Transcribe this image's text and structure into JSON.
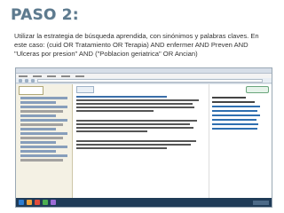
{
  "title": "PASO 2:",
  "instructions": "Utilizar la estrategia de búsqueda aprendida, con sinónimos y palabras claves. En este caso: (cuid OR Tratamiento OR Terapia) AND enfermer AND Preven AND \"Ulceras por presion\" AND (\"Poblacion geriatrica\" OR Ancian)",
  "screenshot": {
    "description_icons": [
      "browser-window",
      "database-logo",
      "results-list"
    ],
    "taskbar_icon_colors": [
      "#2e7dd1",
      "#f0a23b",
      "#e24b3b",
      "#4caf50",
      "#9c6bd6"
    ]
  }
}
